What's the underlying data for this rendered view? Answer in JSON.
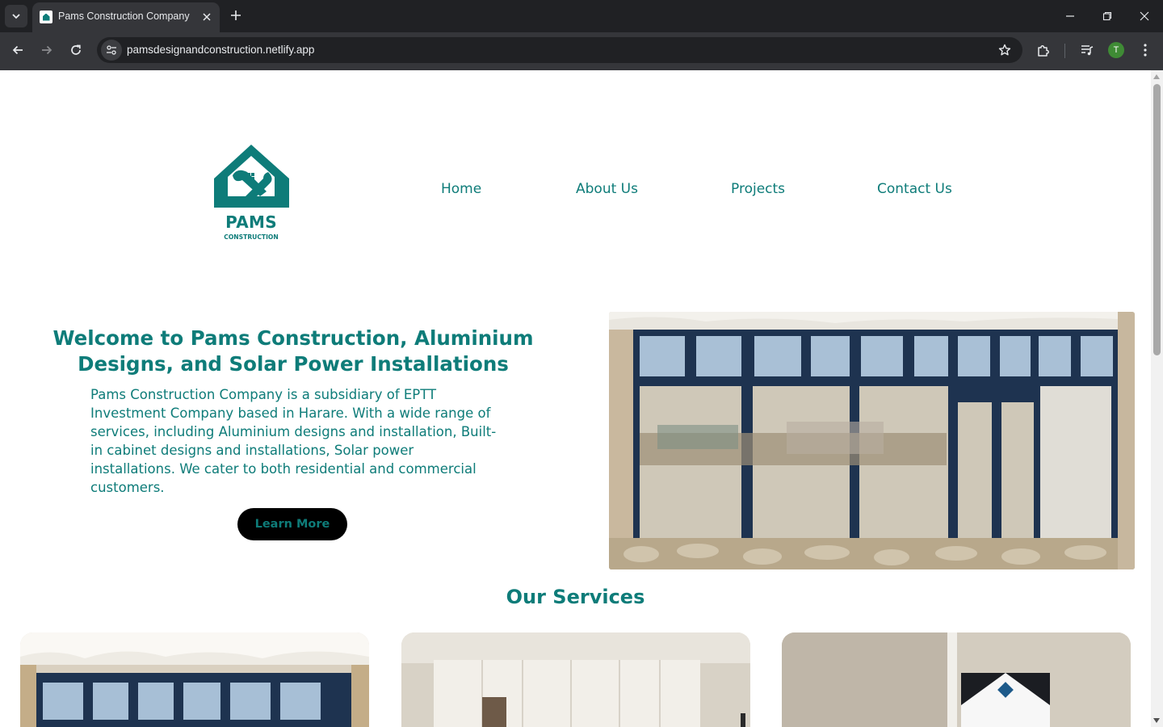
{
  "browser": {
    "tab": {
      "title": "Pams Construction Company"
    },
    "url": "pamsdesignandconstruction.netlify.app",
    "profile_initial": "T",
    "icons": [
      "tab-list-icon",
      "favicon-icon",
      "close-icon",
      "new-tab-icon",
      "minimize-icon",
      "restore-icon",
      "window-close-icon",
      "back-icon",
      "forward-icon",
      "reload-icon",
      "site-info-icon",
      "bookmark-star-icon",
      "extensions-icon",
      "media-controls-icon",
      "menu-icon"
    ]
  },
  "site": {
    "logo": {
      "word": "PAMS",
      "subtitle": "CONSTRUCTION"
    },
    "nav": [
      "Home",
      "About Us",
      "Projects",
      "Contact Us"
    ],
    "hero": {
      "heading": "Welcome to Pams Construction, Aluminium Designs, and Solar Power Installations",
      "body": "Pams Construction Company is a subsidiary of EPTT Investment Company based in Harare. With a wide range of services, including Aluminium designs and installation, Built-in cabinet designs and installations, Solar power installations. We cater to both residential and commercial customers.",
      "cta": "Learn More"
    },
    "services": {
      "title": "Our Services"
    },
    "colors": {
      "brand": "#0e7c79",
      "button": "#000000",
      "chrome_dark": "#202124",
      "chrome_toolbar": "#35363a"
    }
  }
}
